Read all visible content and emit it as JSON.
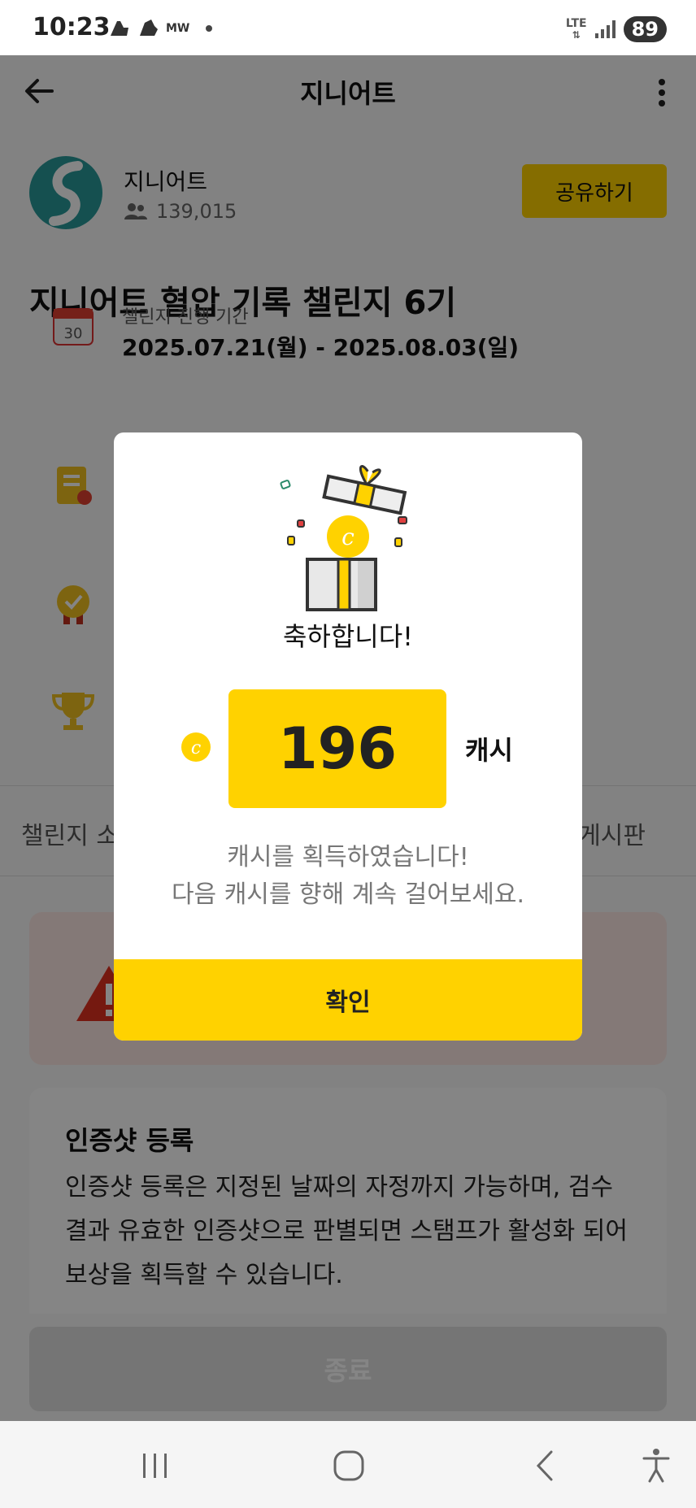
{
  "status_bar": {
    "time": "10:23",
    "notif_text": "MW",
    "network": "LTE",
    "battery": "89"
  },
  "header": {
    "title": "지니어트"
  },
  "channel": {
    "name": "지니어트",
    "members": "139,015",
    "share_label": "공유하기"
  },
  "challenge": {
    "title": "지니어트 혈압 기록 챌린지 6기",
    "period_label": "챌린지 진행 기간",
    "period_value": "2025.07.21(월) - 2025.08.03(일)",
    "calendar_day": "30"
  },
  "tabs": {
    "left_label": "챌린지 소",
    "right_label": "게시판"
  },
  "guide": {
    "title": "인증샷 등록",
    "body": "인증샷 등록은 지정된 날짜의 자정까지 가능하며, 검수 결과 유효한 인증샷으로 판별되면 스탬프가 활성화 되어 보상을 획득할 수 있습니다."
  },
  "end_button": "종료",
  "dialog": {
    "title": "축하합니다!",
    "coin_symbol": "c",
    "amount": "196",
    "unit": "캐시",
    "message_line1": "캐시를 획득하였습니다!",
    "message_line2": "다음 캐시를 향해 계속 걸어보세요.",
    "confirm_label": "확인"
  },
  "colors": {
    "accent": "#ffd200",
    "overlay": "#000000",
    "warning_bg": "#fde8e4"
  }
}
